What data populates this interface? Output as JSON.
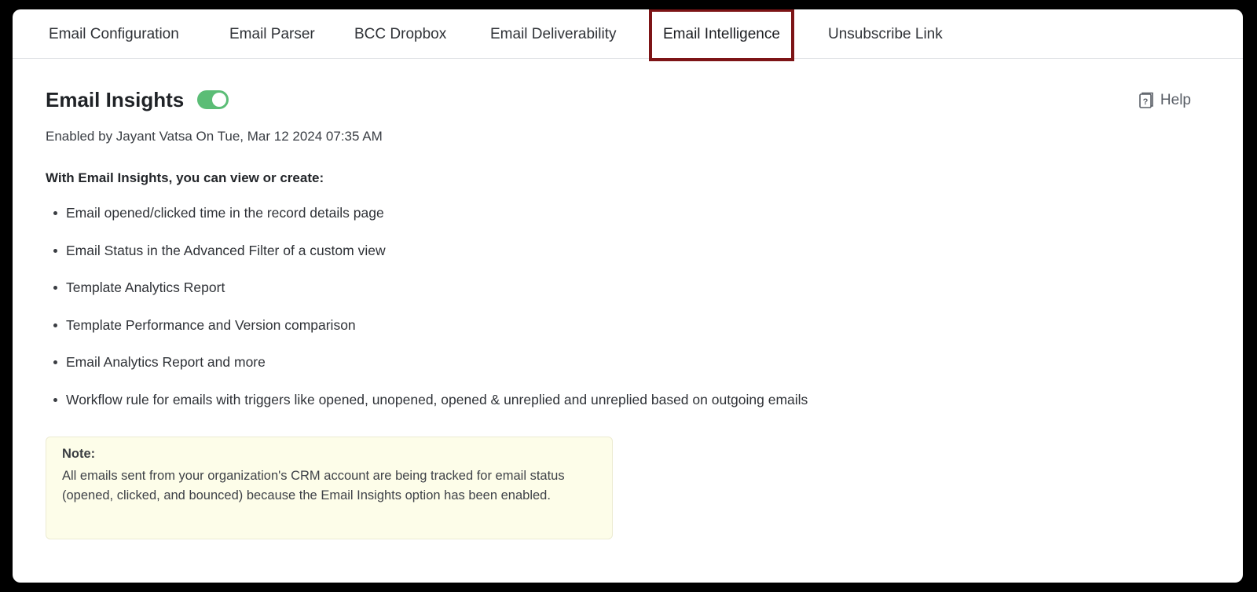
{
  "tabs": [
    {
      "label": "Email Configuration"
    },
    {
      "label": "Email Parser"
    },
    {
      "label": "BCC Dropbox"
    },
    {
      "label": "Email Deliverability"
    },
    {
      "label": "Email Intelligence",
      "active": true
    },
    {
      "label": "Unsubscribe Link"
    }
  ],
  "header": {
    "title": "Email Insights",
    "toggle_state": "on",
    "help_label": "Help"
  },
  "status": {
    "enabled_by": "Enabled by Jayant Vatsa On Tue, Mar 12 2024 07:35 AM"
  },
  "intro": "With Email Insights, you can view or create:",
  "features": [
    "Email opened/clicked time in the record details page",
    "Email Status in the Advanced Filter of a custom view",
    "Template Analytics Report",
    "Template Performance and Version comparison",
    "Email Analytics Report and more",
    "Workflow rule for emails with triggers like opened, unopened, opened & unreplied and unreplied based on outgoing emails"
  ],
  "note": {
    "title": "Note:",
    "text": "All emails sent from your organization's CRM account are being tracked for email status (opened, clicked, and bounced) because the Email Insights option has been enabled."
  },
  "colors": {
    "toggle_on": "#5bbd76",
    "active_tab_highlight": "#7d1416",
    "note_background": "#fdfde9"
  }
}
